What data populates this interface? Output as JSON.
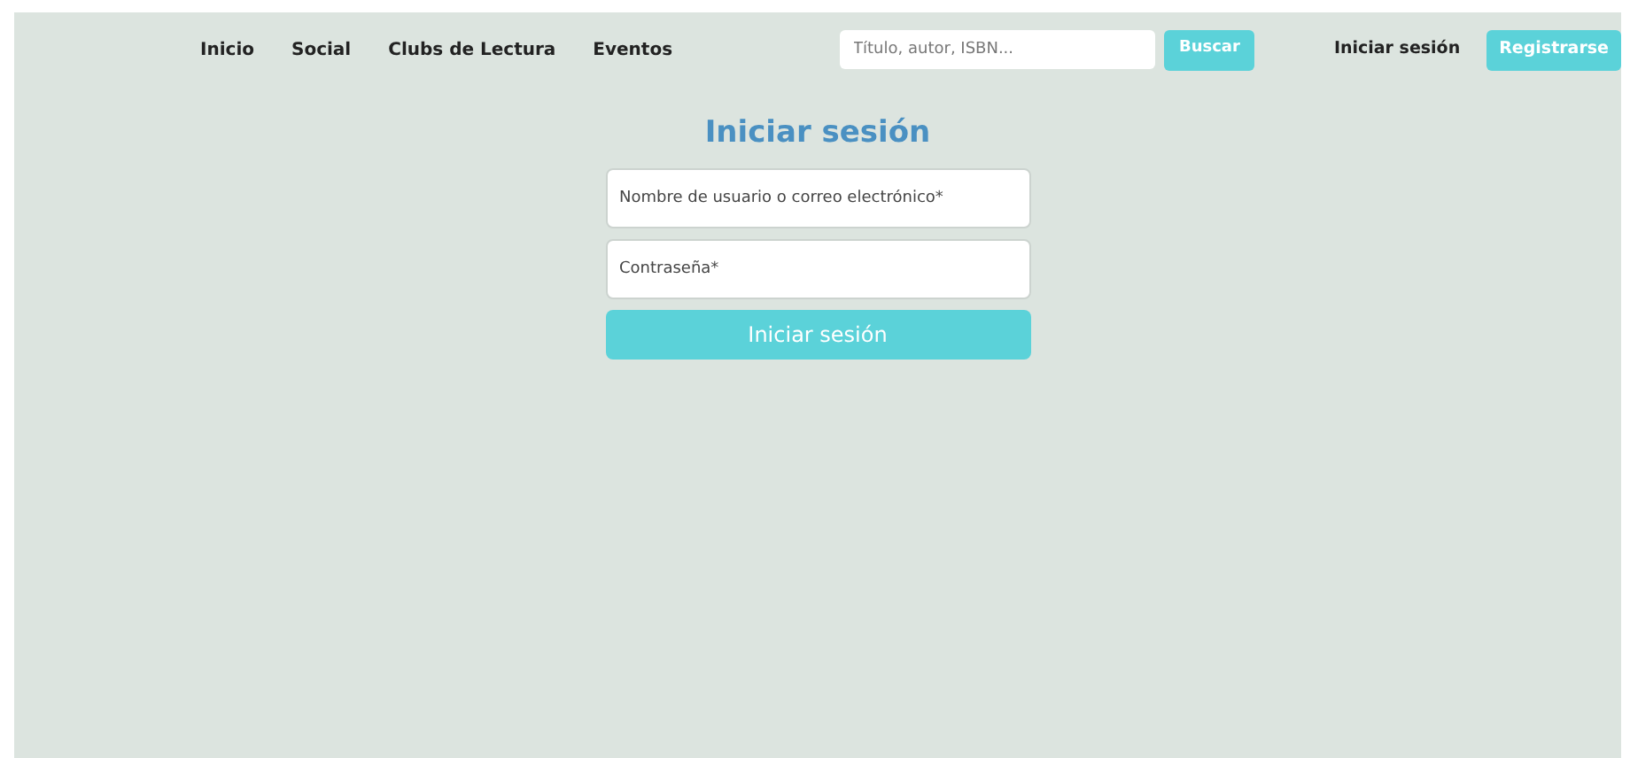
{
  "nav": {
    "links": [
      "Inicio",
      "Social",
      "Clubs de Lectura",
      "Eventos"
    ],
    "search": {
      "placeholder": "Título, autor, ISBN..."
    },
    "search_button": "Buscar",
    "login_link": "Iniciar sesión",
    "register_button": "Registrarse"
  },
  "form": {
    "title": "Iniciar sesión",
    "fields": [
      {
        "placeholder": "Nombre de usuario o correo electrónico*"
      },
      {
        "placeholder": "Contraseña*"
      }
    ],
    "submit": "Iniciar sesión"
  }
}
